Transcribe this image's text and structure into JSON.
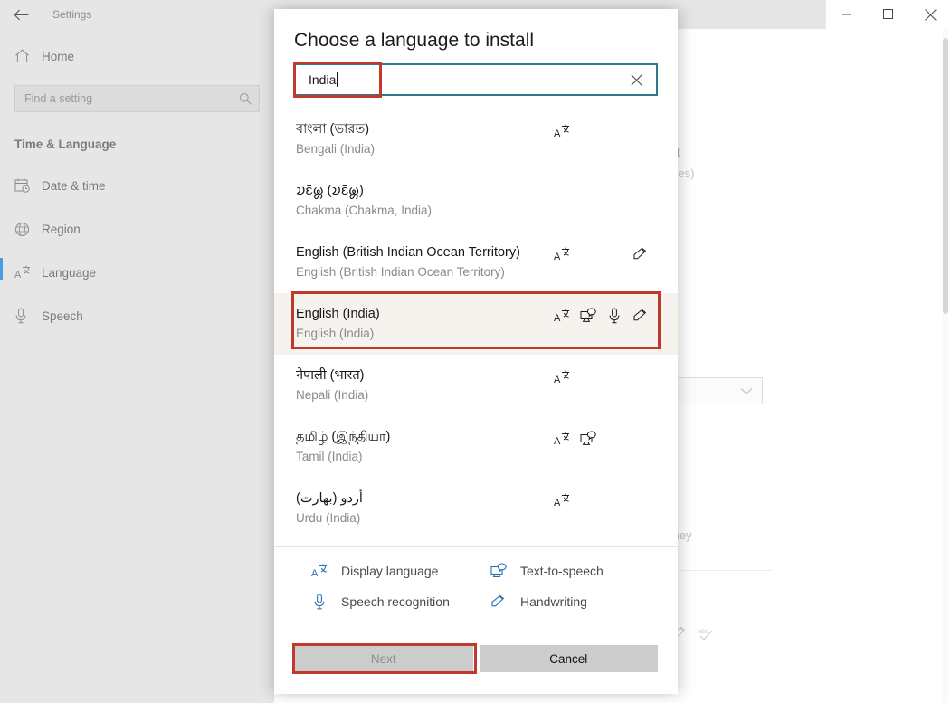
{
  "window": {
    "title": "Settings",
    "back_icon": "back-arrow-icon",
    "controls": {
      "minimize": "minimize-icon",
      "maximize": "maximize-icon",
      "close": "close-icon"
    }
  },
  "sidebar": {
    "home_label": "Home",
    "search_placeholder": "Find a setting",
    "search_icon": "search-icon",
    "section_header": "Time & Language",
    "items": [
      {
        "label": "Date & time",
        "icon": "calendar-clock-icon",
        "selected": false
      },
      {
        "label": "Region",
        "icon": "globe-icon",
        "selected": false
      },
      {
        "label": "Language",
        "icon": "display-language-icon",
        "selected": true
      },
      {
        "label": "Speech",
        "icon": "microphone-icon",
        "selected": false
      }
    ]
  },
  "background": {
    "regional_format_title": "at",
    "regional_format_value": "tates)",
    "list_fragment": "s",
    "paragraph_fragment": "they",
    "dropdown_icon": "chevron-down-icon",
    "icons": [
      "handwriting-icon",
      "abc-check-icon"
    ]
  },
  "dialog": {
    "title": "Choose a language to install",
    "search": {
      "value": "India",
      "clear_icon": "clear-x-icon"
    },
    "languages": [
      {
        "native": "বাংলা (ভারত)",
        "english": "Bengali (India)",
        "features": [
          "display-language",
          "none",
          "none",
          "none"
        ],
        "selected": false
      },
      {
        "native": "𑄌𑄋𑄴𑄟𑄳𑄦 (𑄌𑄋𑄴𑄟𑄳𑄦)",
        "english": "Chakma (Chakma, India)",
        "features": [
          "none",
          "none",
          "none",
          "none"
        ],
        "selected": false
      },
      {
        "native": "English (British Indian Ocean Territory)",
        "english": "English (British Indian Ocean Territory)",
        "features": [
          "display-language",
          "none",
          "none",
          "handwriting"
        ],
        "selected": false
      },
      {
        "native": "English (India)",
        "english": "English (India)",
        "features": [
          "display-language",
          "text-to-speech",
          "speech-recognition",
          "handwriting"
        ],
        "selected": true
      },
      {
        "native": "नेपाली (भारत)",
        "english": "Nepali (India)",
        "features": [
          "display-language",
          "none",
          "none",
          "none"
        ],
        "selected": false
      },
      {
        "native": "தமிழ் (இந்தியா)",
        "english": "Tamil (India)",
        "features": [
          "display-language",
          "text-to-speech",
          "none",
          "none"
        ],
        "selected": false
      },
      {
        "native": "أردو (بھارت)",
        "english": "Urdu (India)",
        "features": [
          "display-language",
          "none",
          "none",
          "none"
        ],
        "selected": false
      }
    ],
    "legend": [
      {
        "label": "Display language",
        "icon": "display-language-icon"
      },
      {
        "label": "Text-to-speech",
        "icon": "text-to-speech-icon"
      },
      {
        "label": "Speech recognition",
        "icon": "microphone-icon"
      },
      {
        "label": "Handwriting",
        "icon": "handwriting-icon"
      }
    ],
    "buttons": {
      "next": "Next",
      "cancel": "Cancel"
    }
  },
  "annotations": {
    "accent_color": "#c0392b",
    "focus_border_color": "#2b7b8f",
    "legend_icon_color": "#2572b8",
    "selected_row_background": "#f6f3ef"
  }
}
